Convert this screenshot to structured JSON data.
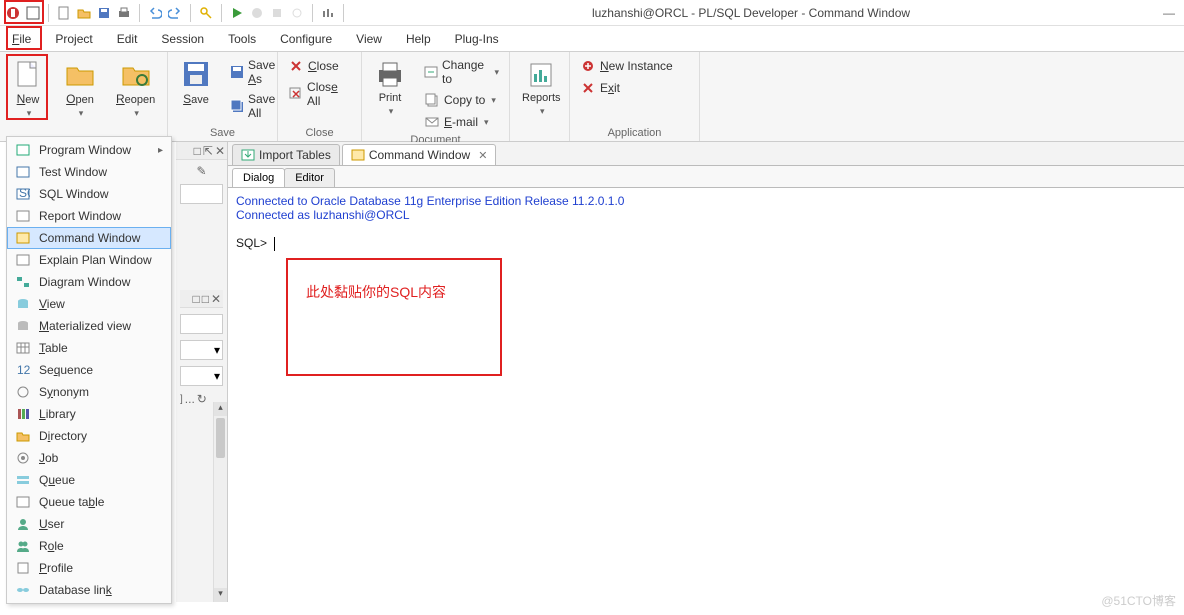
{
  "titlebar": {
    "title": "luzhanshi@ORCL - PL/SQL Developer - Command Window"
  },
  "menubar": {
    "file": "File",
    "project": "Project",
    "edit": "Edit",
    "session": "Session",
    "tools": "Tools",
    "configure": "Configure",
    "view": "View",
    "help": "Help",
    "plugins": "Plug-Ins"
  },
  "ribbon": {
    "new": "New",
    "open": "Open",
    "reopen": "Reopen",
    "save": "Save",
    "save_as": "Save As",
    "save_all": "Save All",
    "save_group": "Save",
    "close": "Close",
    "close_all": "Close All",
    "close_group": "Close",
    "print": "Print",
    "change_to": "Change to",
    "copy_to": "Copy to",
    "email": "E-mail",
    "document_group": "Document",
    "reports": "Reports",
    "new_instance": "New Instance",
    "exit": "Exit",
    "application_group": "Application"
  },
  "file_new_menu": {
    "program_window": "Program Window",
    "test_window": "Test Window",
    "sql_window": "SQL Window",
    "report_window": "Report Window",
    "command_window": "Command Window",
    "explain_plan_window": "Explain Plan Window",
    "diagram_window": "Diagram Window",
    "view": "View",
    "materialized_view": "Materialized view",
    "table": "Table",
    "sequence": "Sequence",
    "synonym": "Synonym",
    "library": "Library",
    "directory": "Directory",
    "job": "Job",
    "queue": "Queue",
    "queue_table": "Queue table",
    "user": "User",
    "role": "Role",
    "profile": "Profile",
    "database_link": "Database link"
  },
  "doc_tabs": {
    "import_tables": "Import Tables",
    "command_window": "Command Window"
  },
  "sub_tabs": {
    "dialog": "Dialog",
    "editor": "Editor"
  },
  "editor": {
    "line1": "Connected to Oracle Database 11g Enterprise Edition Release 11.2.0.1.0",
    "line2": "Connected as luzhanshi@ORCL",
    "prompt": "SQL> "
  },
  "annotation": {
    "paste_hint": "此处黏贴你的SQL内容"
  },
  "side_panel": {
    "header": "□ ⇱ ✕"
  },
  "watermark": "@51CTO博客"
}
